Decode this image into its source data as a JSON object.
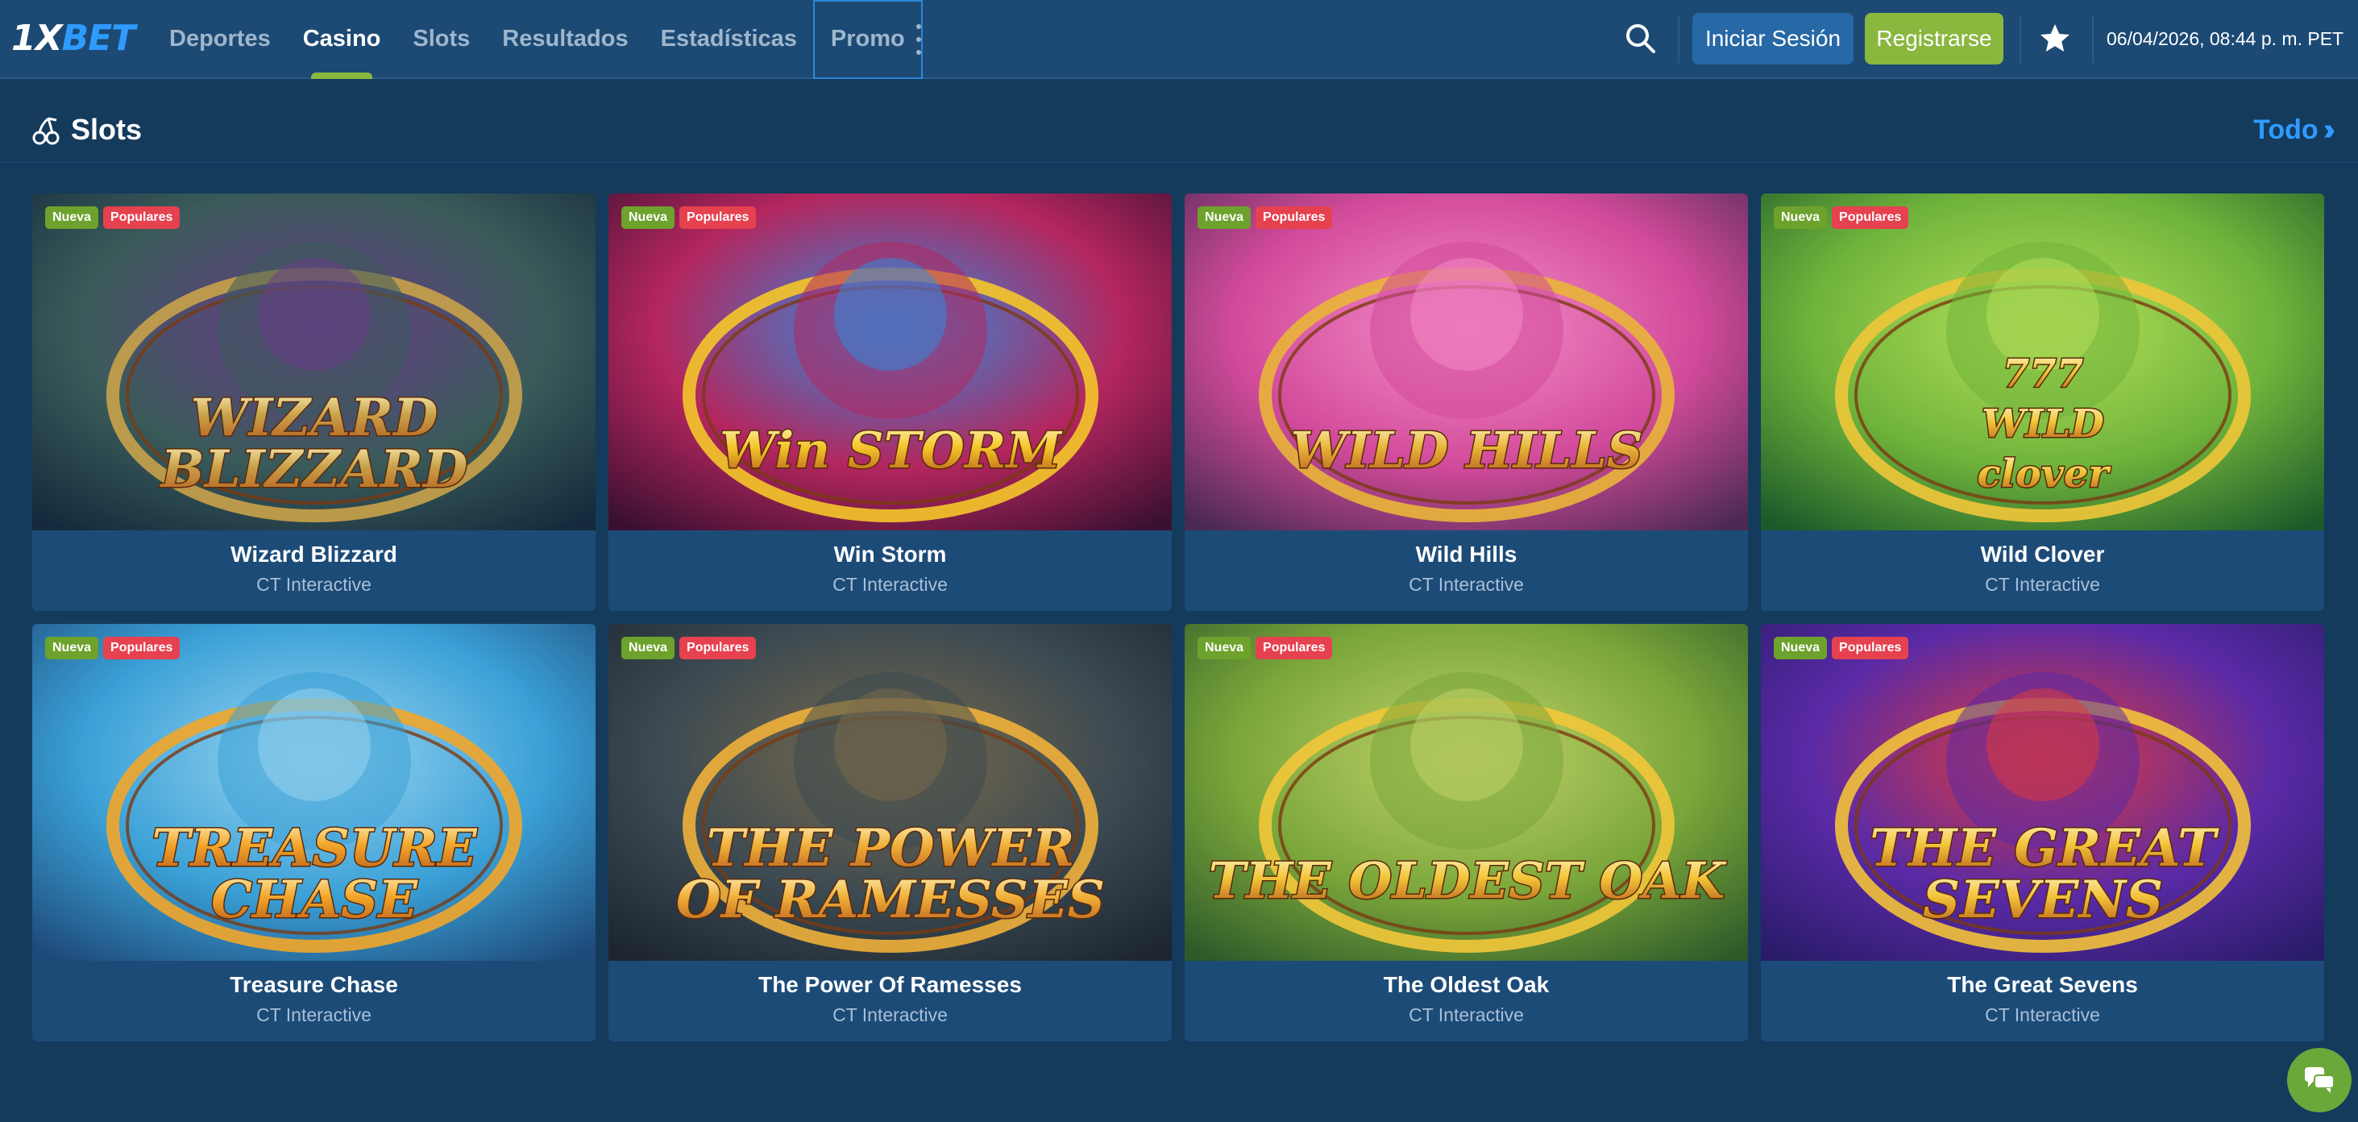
{
  "header": {
    "logo": {
      "prefix": "1",
      "x": "X",
      "suffix": "BET"
    },
    "nav": [
      {
        "label": "Deportes",
        "active": false
      },
      {
        "label": "Casino",
        "active": true
      },
      {
        "label": "Slots",
        "active": false
      },
      {
        "label": "Resultados",
        "active": false
      },
      {
        "label": "Estadísticas",
        "active": false
      },
      {
        "label": "Promo",
        "active": false
      }
    ],
    "login_label": "Iniciar Sesión",
    "register_label": "Registrarse",
    "datetime": "06/04/2026, 08:44 p. m. PET",
    "icons": {
      "search": "search-icon",
      "favorites": "star-icon",
      "more": "more-vertical-icon"
    }
  },
  "section": {
    "title": "Slots",
    "view_all": "Todo",
    "icon": "cherries-icon"
  },
  "badges": {
    "new": "Nueva",
    "popular": "Populares"
  },
  "games": [
    {
      "title": "Wizard Blizzard",
      "provider": "CT Interactive",
      "logo_lines": [
        "WIZARD",
        "BLIZZARD"
      ],
      "palette": [
        "#142a3c",
        "#3a5b5a",
        "#6a3b8a",
        "#c9a24a"
      ]
    },
    {
      "title": "Win Storm",
      "provider": "CT Interactive",
      "logo_lines": [
        "Win STORM"
      ],
      "palette": [
        "#3a1030",
        "#b4265e",
        "#2c8de0",
        "#f5c62a"
      ]
    },
    {
      "title": "Wild Hills",
      "provider": "CT Interactive",
      "logo_lines": [
        "WILD HILLS"
      ],
      "palette": [
        "#4a2a52",
        "#d24a9a",
        "#f58ec8",
        "#e9b53a"
      ]
    },
    {
      "title": "Wild Clover",
      "provider": "CT Interactive",
      "logo_lines": [
        "777",
        "WILD",
        "clover"
      ],
      "palette": [
        "#1d5a2a",
        "#6fb33b",
        "#b7e25a",
        "#f0c73a"
      ]
    },
    {
      "title": "Treasure Chase",
      "provider": "CT Interactive",
      "logo_lines": [
        "TREASURE",
        "CHASE"
      ],
      "palette": [
        "#1e4a7a",
        "#3aa0d6",
        "#9cd6f2",
        "#f2a62a"
      ]
    },
    {
      "title": "The Power Of Ramesses",
      "provider": "CT Interactive",
      "logo_lines": [
        "THE POWER",
        "OF RAMESSES"
      ],
      "palette": [
        "#1c2530",
        "#3c4a52",
        "#7a6a4a",
        "#f0b03a"
      ]
    },
    {
      "title": "The Oldest Oak",
      "provider": "CT Interactive",
      "logo_lines": [
        "THE OLDEST OAK"
      ],
      "palette": [
        "#2e5a2a",
        "#7aa63a",
        "#c4d46a",
        "#f2c63a"
      ]
    },
    {
      "title": "The Great Sevens",
      "provider": "CT Interactive",
      "logo_lines": [
        "THE GREAT",
        "SEVENS"
      ],
      "palette": [
        "#2a1c6a",
        "#5a2aa6",
        "#e23a3a",
        "#f2c23a"
      ]
    }
  ],
  "chat": {
    "icon": "chat-icon"
  }
}
